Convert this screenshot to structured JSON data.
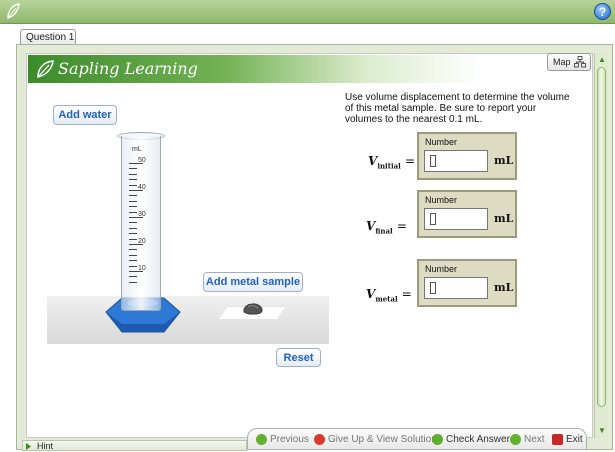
{
  "tab": {
    "label": "Question 1"
  },
  "header": {
    "help_icon": "?",
    "map_label": "Map"
  },
  "banner": {
    "title": "Sapling Learning"
  },
  "buttons": {
    "add_water": "Add water",
    "add_metal": "Add metal sample",
    "reset": "Reset"
  },
  "cylinder": {
    "unit": "mL",
    "ticks": [
      "50",
      "40",
      "30",
      "20",
      "10"
    ]
  },
  "instructions": "Use volume displacement to determine the volume of this metal sample. Be sure to report your volumes to the nearest 0.1 mL.",
  "fields": [
    {
      "symbol": "V",
      "sub": "initial",
      "eq": "=",
      "title": "Number",
      "value": "",
      "unit": "mL"
    },
    {
      "symbol": "V",
      "sub": "final",
      "eq": "=",
      "title": "Number",
      "value": "",
      "unit": "mL"
    },
    {
      "symbol": "V",
      "sub": "metal",
      "eq": "=",
      "title": "Number",
      "value": "",
      "unit": "mL"
    }
  ],
  "footer": {
    "hint": "Hint",
    "previous": "Previous",
    "give_up": "Give Up & View Solution",
    "check": "Check Answer",
    "next": "Next",
    "exit": "Exit"
  },
  "colors": {
    "banner_green": "#3c8b2b",
    "button_text": "#2162c6",
    "field_bg": "#dedbc3",
    "stand_blue": "#2f79d6"
  }
}
